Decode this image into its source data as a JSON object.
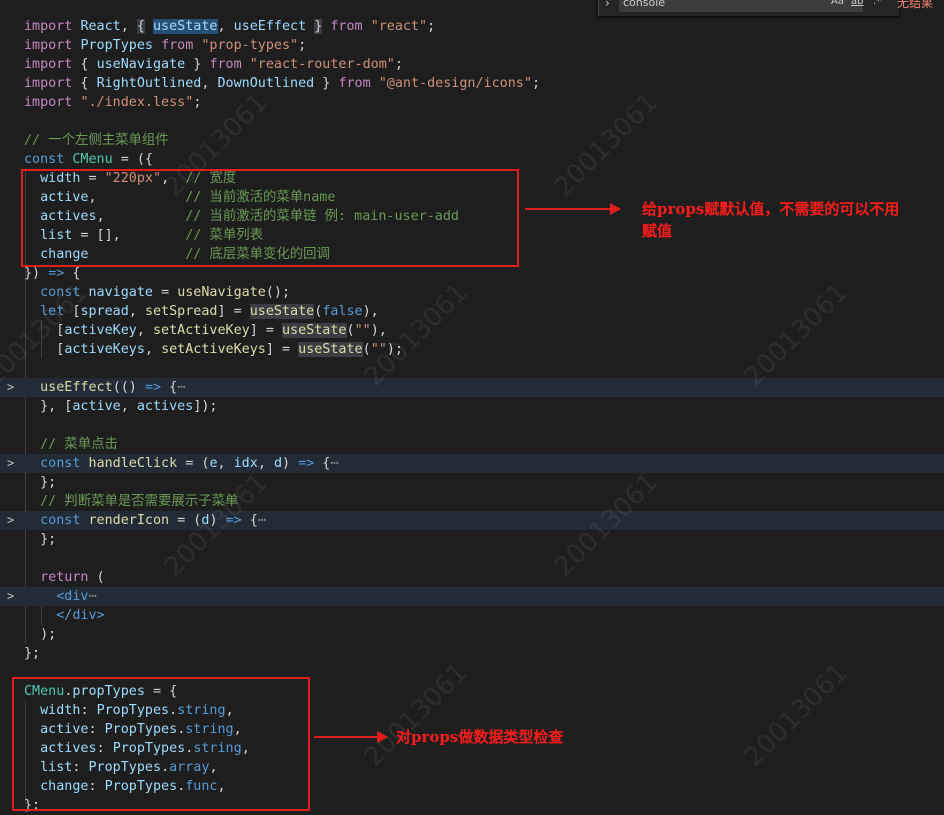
{
  "find_widget": {
    "query": "console",
    "match_case": "Aa",
    "whole_word": "ab",
    "regex": ".*",
    "result": "无结果"
  },
  "code": {
    "l1": {
      "a": "import",
      "b": "React",
      "c": "useState",
      "d": "useEffect",
      "e": "from",
      "f": "\"react\""
    },
    "l2": {
      "a": "import",
      "b": "PropTypes",
      "e": "from",
      "f": "\"prop-types\""
    },
    "l3": {
      "a": "import",
      "b": "useNavigate",
      "e": "from",
      "f": "\"react-router-dom\""
    },
    "l4": {
      "a": "import",
      "b": "RightOutlined",
      "c": "DownOutlined",
      "e": "from",
      "f": "\"@ant-design/icons\""
    },
    "l5": {
      "a": "import",
      "f": "\"./index.less\""
    },
    "l7": {
      "c": "// 一个左侧主菜单组件"
    },
    "l8": {
      "a": "const",
      "b": "CMenu"
    },
    "l9": {
      "a": "width",
      "b": "\"220px\"",
      "c": "// 宽度"
    },
    "l10": {
      "a": "active",
      "c": "// 当前激活的菜单name"
    },
    "l11": {
      "a": "actives",
      "c": "// 当前激活的菜单链 例: main-user-add"
    },
    "l12": {
      "a": "list",
      "c": "// 菜单列表"
    },
    "l13": {
      "a": "change",
      "c": "// 底层菜单变化的回调"
    },
    "l15": {
      "a": "const",
      "b": "navigate",
      "c": "useNavigate"
    },
    "l16": {
      "a": "let",
      "b": "spread",
      "c": "setSpread",
      "d": "useState",
      "e": "false"
    },
    "l17": {
      "b": "activeKey",
      "c": "setActiveKey",
      "d": "useState",
      "e": "\"\""
    },
    "l18": {
      "b": "activeKeys",
      "c": "setActiveKeys",
      "d": "useState",
      "e": "\"\""
    },
    "l20": {
      "a": "useEffect"
    },
    "l21": {
      "a": "active",
      "b": "actives"
    },
    "l23": {
      "c": "// 菜单点击"
    },
    "l24": {
      "a": "const",
      "b": "handleClick",
      "c": "e",
      "d": "idx",
      "e": "d"
    },
    "l26": {
      "c": "// 判断菜单是否需要展示子菜单"
    },
    "l27": {
      "a": "const",
      "b": "renderIcon",
      "c": "d"
    },
    "l30": {
      "a": "return"
    },
    "l31": {
      "a": "<div"
    },
    "l32": {
      "a": "</div>"
    },
    "l36": {
      "a": "CMenu",
      "b": "propTypes"
    },
    "l37": {
      "a": "width",
      "b": "PropTypes",
      "c": "string"
    },
    "l38": {
      "a": "active",
      "b": "PropTypes",
      "c": "string"
    },
    "l39": {
      "a": "actives",
      "b": "PropTypes",
      "c": "string"
    },
    "l40": {
      "a": "list",
      "b": "PropTypes",
      "c": "array"
    },
    "l41": {
      "a": "change",
      "b": "PropTypes",
      "c": "func"
    }
  },
  "annotations": {
    "defaults_note_line1": "给props赋默认值，不需要的可以不用",
    "defaults_note_line2": "赋值",
    "proptypes_note": "对props做数据类型检查"
  },
  "watermark": "20013061",
  "colors": {
    "background": "#1e1e1e",
    "annotation_red": "#e31c1c",
    "keyword": "#569cd6",
    "string": "#ce9178",
    "comment": "#6a9955",
    "variable": "#9cdcfe",
    "function": "#dcdcaa"
  }
}
